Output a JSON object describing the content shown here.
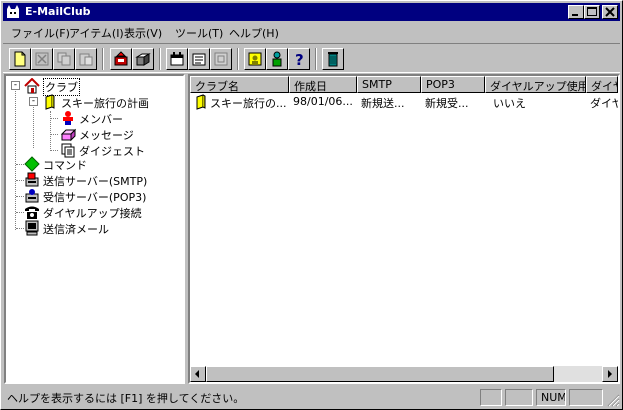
{
  "window": {
    "title": "E-MailClub"
  },
  "menu": [
    {
      "label": "ファイル(F)"
    },
    {
      "label": "アイテム(I)"
    },
    {
      "label": "表示(V)"
    },
    {
      "label": "ツール(T)"
    },
    {
      "label": "ヘルプ(H)"
    }
  ],
  "tree": {
    "root": "クラブ",
    "club": "スキー旅行の計画",
    "members": "メンバー",
    "messages": "メッセージ",
    "digest": "ダイジェスト",
    "commands": "コマンド",
    "smtp": "送信サーバー(SMTP)",
    "pop3": "受信サーバー(POP3)",
    "dialup": "ダイヤルアップ接続",
    "sent": "送信済メール"
  },
  "list": {
    "columns": [
      "クラブ名",
      "作成日",
      "SMTP",
      "POP3",
      "ダイヤルアップ使用",
      "ダイヤル"
    ],
    "rows": [
      [
        "スキー旅行の...",
        "98/01/06...",
        "新規送...",
        "新規受...",
        "いいえ",
        "ダイヤ"
      ]
    ]
  },
  "status": {
    "message": "ヘルプを表示するには [F1] を押してください。",
    "num": "NUM"
  },
  "colors": {
    "title_bar": "#000080",
    "face": "#c0c0c0"
  }
}
